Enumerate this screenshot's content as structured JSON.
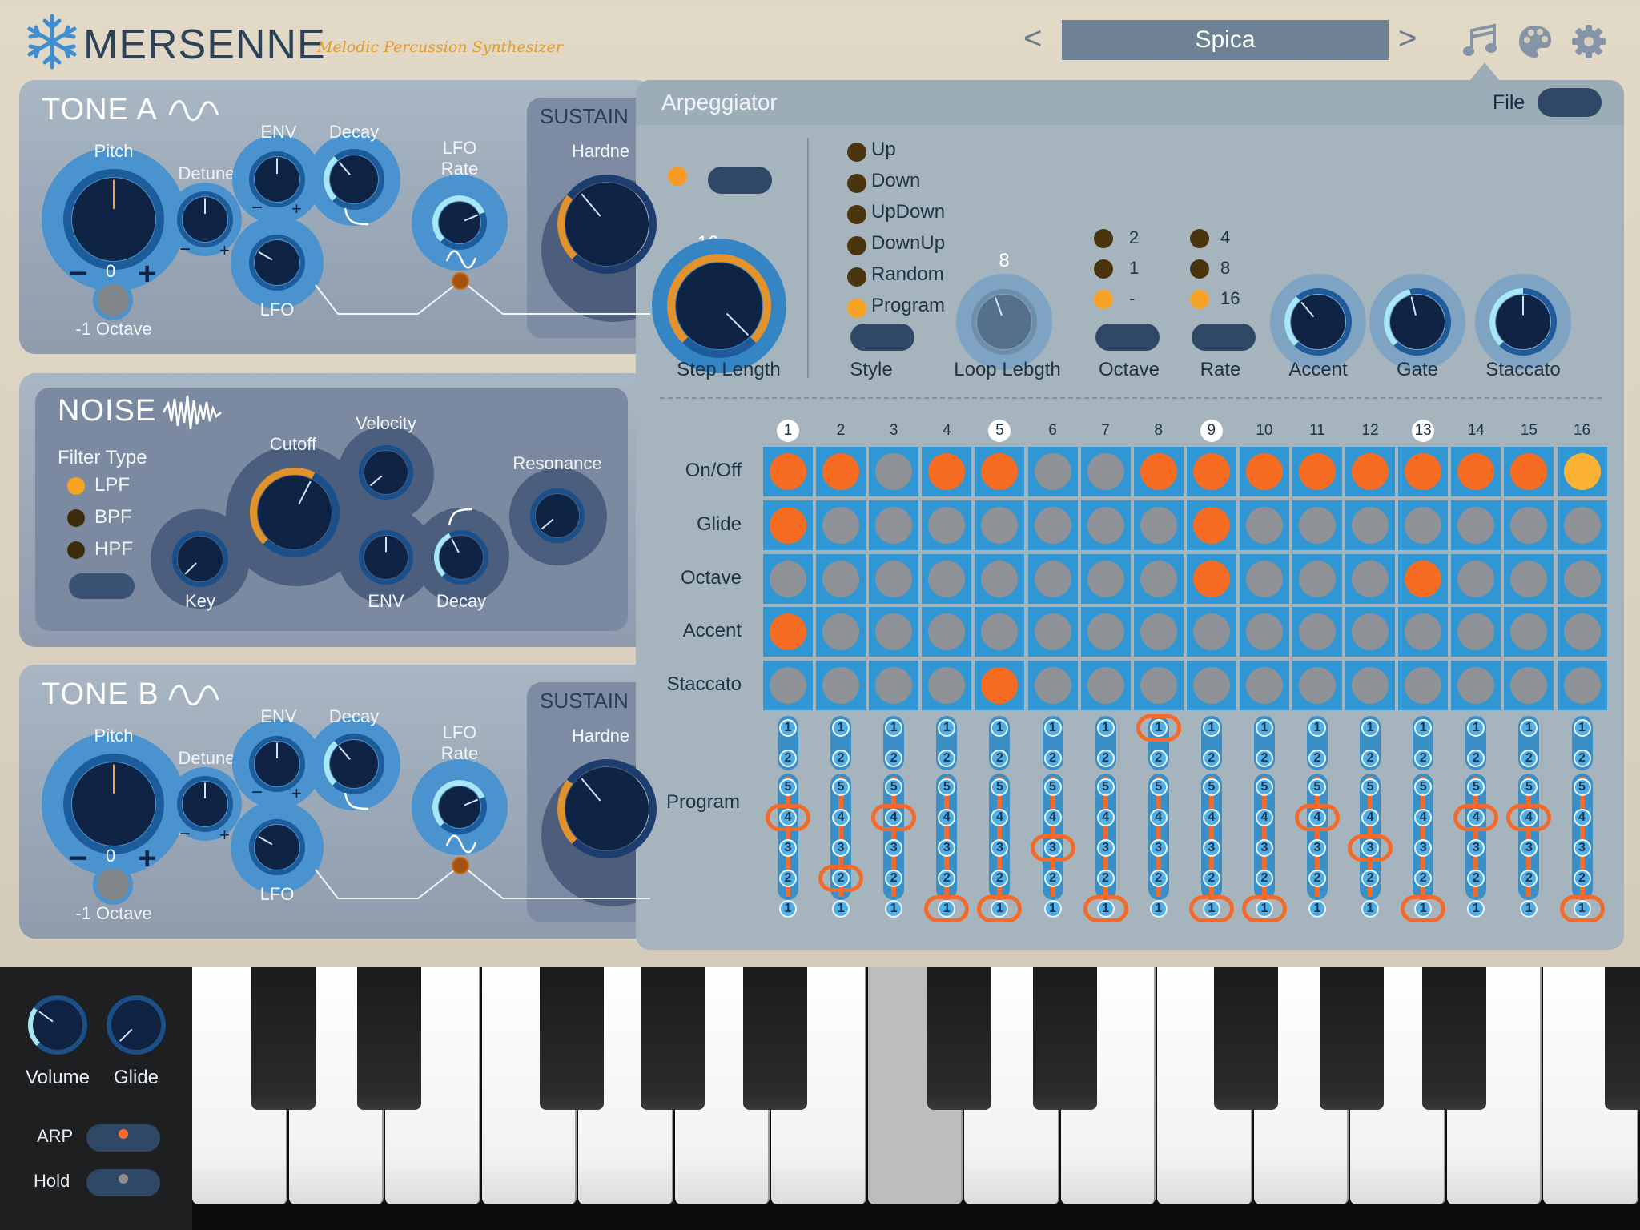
{
  "header": {
    "app_title": "MERSENNE",
    "subtitle": "Melodic Percussion Synthesizer",
    "prev_label": "<",
    "next_label": ">",
    "preset_name": "Spica",
    "icons": [
      "snowflake-logo",
      "music-notes-icon",
      "palette-icon",
      "gear-icon"
    ]
  },
  "tone_a": {
    "title": "TONE A",
    "pitch_label": "Pitch",
    "pitch_value": "0",
    "minus": "−",
    "plus": "+",
    "detune_label": "Detune",
    "env_label": "ENV",
    "decay_label": "Decay",
    "lfo_label": "LFO",
    "lfo_rate_label": "LFO\nRate",
    "octave_label": "-1 Octave",
    "sustain_label": "SUSTAIN",
    "hardness_label": "Hardne"
  },
  "noise": {
    "title": "NOISE",
    "filter_type_label": "Filter Type",
    "filter_options": [
      {
        "label": "LPF",
        "selected": true
      },
      {
        "label": "BPF",
        "selected": false
      },
      {
        "label": "HPF",
        "selected": false
      }
    ],
    "key_label": "Key",
    "cutoff_label": "Cutoff",
    "velocity_label": "Velocity",
    "env_label": "ENV",
    "decay_label": "Decay",
    "resonance_label": "Resonance"
  },
  "tone_b": {
    "title": "TONE B",
    "pitch_label": "Pitch",
    "pitch_value": "0",
    "minus": "−",
    "plus": "+",
    "detune_label": "Detune",
    "env_label": "ENV",
    "decay_label": "Decay",
    "lfo_label": "LFO",
    "lfo_rate_label": "LFO\nRate",
    "octave_label": "-1 Octave",
    "sustain_label": "SUSTAIN",
    "hardness_label": "Hardne"
  },
  "arp": {
    "title": "Arpeggiator",
    "file_label": "File",
    "step_length_label": "Step Length",
    "step_length_value": "16",
    "style_label": "Style",
    "style_options": [
      {
        "label": "Up",
        "selected": false
      },
      {
        "label": "Down",
        "selected": false
      },
      {
        "label": "UpDown",
        "selected": false
      },
      {
        "label": "DownUp",
        "selected": false
      },
      {
        "label": "Random",
        "selected": false
      },
      {
        "label": "Program",
        "selected": true
      }
    ],
    "loop_length_label": "Loop Lebgth",
    "loop_length_value": "8",
    "octave_label": "Octave",
    "octave_options": [
      {
        "label": "2",
        "selected": false
      },
      {
        "label": "1",
        "selected": false
      },
      {
        "label": "-",
        "selected": true
      }
    ],
    "rate_label": "Rate",
    "rate_options": [
      {
        "label": "4",
        "selected": false
      },
      {
        "label": "8",
        "selected": false
      },
      {
        "label": "16",
        "selected": true
      }
    ],
    "accent_label": "Accent",
    "gate_label": "Gate",
    "staccato_label": "Staccato",
    "steps": [
      "1",
      "2",
      "3",
      "4",
      "5",
      "6",
      "7",
      "8",
      "9",
      "10",
      "11",
      "12",
      "13",
      "14",
      "15",
      "16"
    ],
    "highlighted_steps": [
      1,
      5,
      9,
      13
    ],
    "rows": [
      {
        "label": "On/Off",
        "values": [
          1,
          1,
          0,
          1,
          1,
          0,
          0,
          1,
          1,
          1,
          1,
          1,
          1,
          1,
          1,
          2
        ]
      },
      {
        "label": "Glide",
        "values": [
          1,
          0,
          0,
          0,
          0,
          0,
          0,
          0,
          1,
          0,
          0,
          0,
          0,
          0,
          0,
          0
        ]
      },
      {
        "label": "Octave",
        "values": [
          0,
          0,
          0,
          0,
          0,
          0,
          0,
          0,
          1,
          0,
          0,
          0,
          1,
          0,
          0,
          0
        ]
      },
      {
        "label": "Accent",
        "values": [
          1,
          0,
          0,
          0,
          0,
          0,
          0,
          0,
          0,
          0,
          0,
          0,
          0,
          0,
          0,
          0
        ]
      },
      {
        "label": "Staccato",
        "values": [
          0,
          0,
          0,
          0,
          1,
          0,
          0,
          0,
          0,
          0,
          0,
          0,
          0,
          0,
          0,
          0
        ]
      }
    ],
    "program_label": "Program",
    "program_top": [
      "1",
      "2"
    ],
    "program_bottom": [
      "5",
      "4",
      "3",
      "2",
      "1"
    ],
    "program_selected": [
      "4",
      "2",
      "4",
      "1",
      "1",
      "3",
      "1",
      "1t",
      "1",
      "1",
      "4",
      "3",
      "1",
      "4",
      "4",
      "1"
    ]
  },
  "left_bar": {
    "volume_label": "Volume",
    "glide_label": "Glide",
    "arp_label": "ARP",
    "hold_label": "Hold"
  },
  "colors": {
    "accent_orange": "#f66c22",
    "knob_blue": "#3b8fcb",
    "dark_navy": "#0f2345",
    "cell_blue": "#3196d4",
    "off_gray": "#8e9196"
  }
}
